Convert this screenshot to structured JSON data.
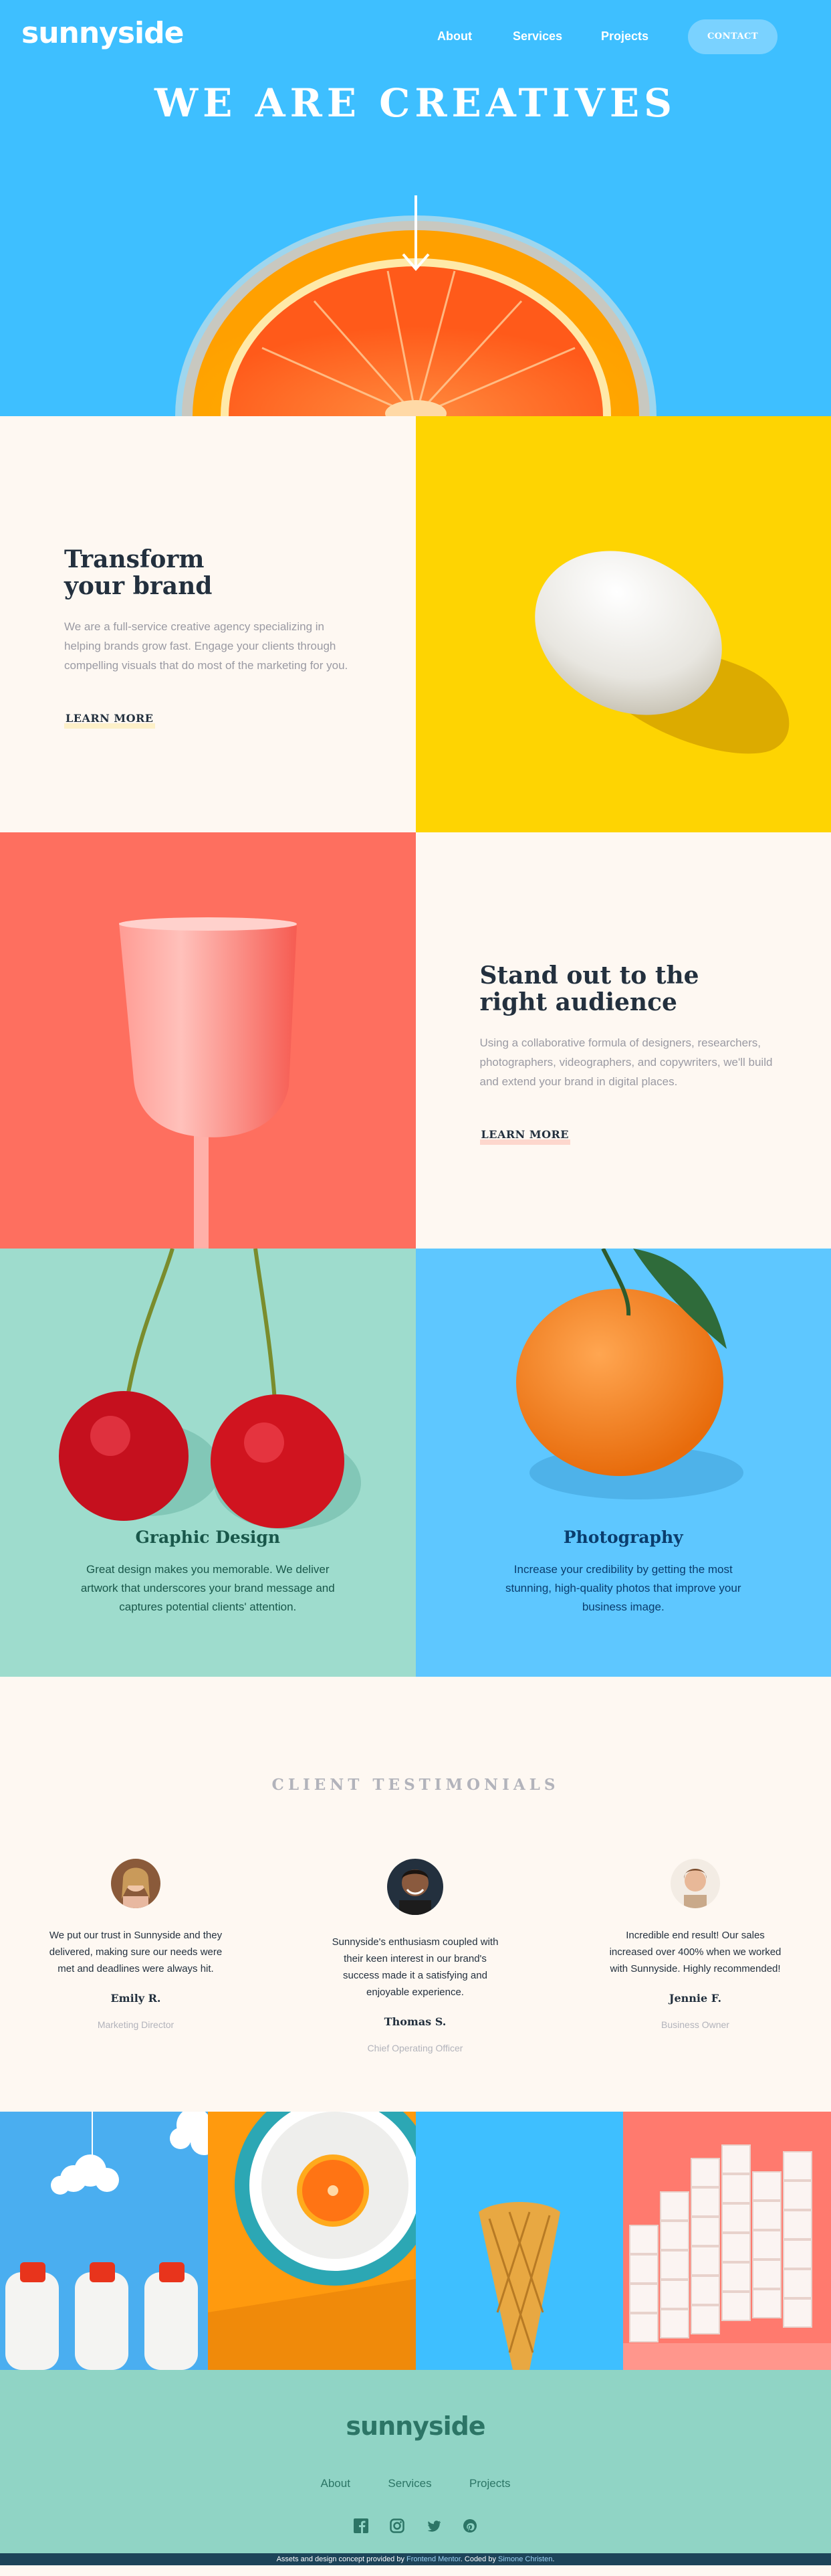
{
  "nav": {
    "logo": "sunnyside",
    "links": [
      "About",
      "Services",
      "Projects"
    ],
    "contact": "CONTACT"
  },
  "hero": {
    "title": "WE ARE CREATIVES"
  },
  "features": [
    {
      "title_line1": "Transform",
      "title_line2": "your brand",
      "body": "We are a full-service creative agency specializing in helping brands grow fast. Engage your clients through compelling visuals that do most of the marketing for you.",
      "cta": "LEARN MORE"
    },
    {
      "title_line1": "Stand out to the",
      "title_line2": "right audience",
      "body": "Using a collaborative formula of designers, researchers, photographers, videographers, and copywriters, we'll build and extend your brand in digital places.",
      "cta": "LEARN MORE"
    }
  ],
  "services": [
    {
      "title": "Graphic Design",
      "body": "Great design makes you memorable. We deliver artwork that underscores your brand message and captures potential clients' attention.",
      "text_color": "#19574a"
    },
    {
      "title": "Photography",
      "body": "Increase your credibility by getting the most stunning, high-quality photos that improve your business image.",
      "text_color": "#0a3d6e"
    }
  ],
  "testimonials": {
    "heading": "CLIENT TESTIMONIALS",
    "items": [
      {
        "quote": "We put our trust in Sunnyside and they delivered, making sure our needs were met and deadlines were always hit.",
        "name": "Emily R.",
        "role": "Marketing Director"
      },
      {
        "quote": "Sunnyside's enthusiasm coupled with their keen interest in our brand's success made it a satisfying and enjoyable experience.",
        "name": "Thomas S.",
        "role": "Chief Operating Officer"
      },
      {
        "quote": "Incredible end result! Our sales increased over 400% when we worked with Sunnyside. Highly recommended!",
        "name": "Jennie F.",
        "role": "Business Owner"
      }
    ]
  },
  "footer": {
    "logo": "sunnyside",
    "links": [
      "About",
      "Services",
      "Projects"
    ],
    "social_icons": [
      "facebook-icon",
      "instagram-icon",
      "twitter-icon",
      "pinterest-icon"
    ],
    "attribution": {
      "prefix": "Assets and design concept provided by",
      "fm": "Frontend Mentor",
      "coded": ". Coded by",
      "author": "Simone Christen",
      "suffix": "."
    }
  },
  "colors": {
    "hero_blue": "#3ebfff",
    "egg_yellow": "#fed402",
    "cup_coral": "#fe6f5f",
    "cherry_teal": "#9edccd",
    "orange_blue": "#5ec7ff",
    "footer_teal": "#90d4c5"
  }
}
